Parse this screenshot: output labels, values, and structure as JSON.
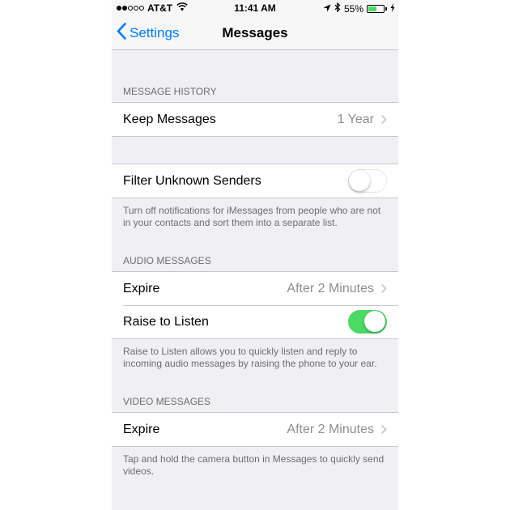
{
  "status_bar": {
    "carrier": "AT&T",
    "signal_bars_filled": 2,
    "signal_bars_total": 5,
    "time": "11:41 AM",
    "battery_percent_label": "55%",
    "battery_level": 0.55,
    "icons": [
      "wifi-icon",
      "location-arrow-icon",
      "bluetooth-icon",
      "battery-icon",
      "charging-bolt-icon"
    ]
  },
  "nav": {
    "back_label": "Settings",
    "title": "Messages"
  },
  "sections": {
    "message_history": {
      "header": "MESSAGE HISTORY",
      "keep_messages": {
        "label": "Keep Messages",
        "value": "1 Year"
      }
    },
    "filter": {
      "label": "Filter Unknown Senders",
      "enabled": false,
      "footer": "Turn off notifications for iMessages from people who are not in your contacts and sort them into a separate list."
    },
    "audio_messages": {
      "header": "AUDIO MESSAGES",
      "expire": {
        "label": "Expire",
        "value": "After 2 Minutes"
      },
      "raise_to_listen": {
        "label": "Raise to Listen",
        "enabled": true
      },
      "footer": "Raise to Listen allows you to quickly listen and reply to incoming audio messages by raising the phone to your ear."
    },
    "video_messages": {
      "header": "VIDEO MESSAGES",
      "expire": {
        "label": "Expire",
        "value": "After 2 Minutes"
      },
      "footer": "Tap and hold the camera button in Messages to quickly send videos."
    }
  },
  "colors": {
    "accent": "#007aff",
    "toggle_on": "#4cd964",
    "background": "#efeff4",
    "secondary_text": "#8e8e93"
  }
}
